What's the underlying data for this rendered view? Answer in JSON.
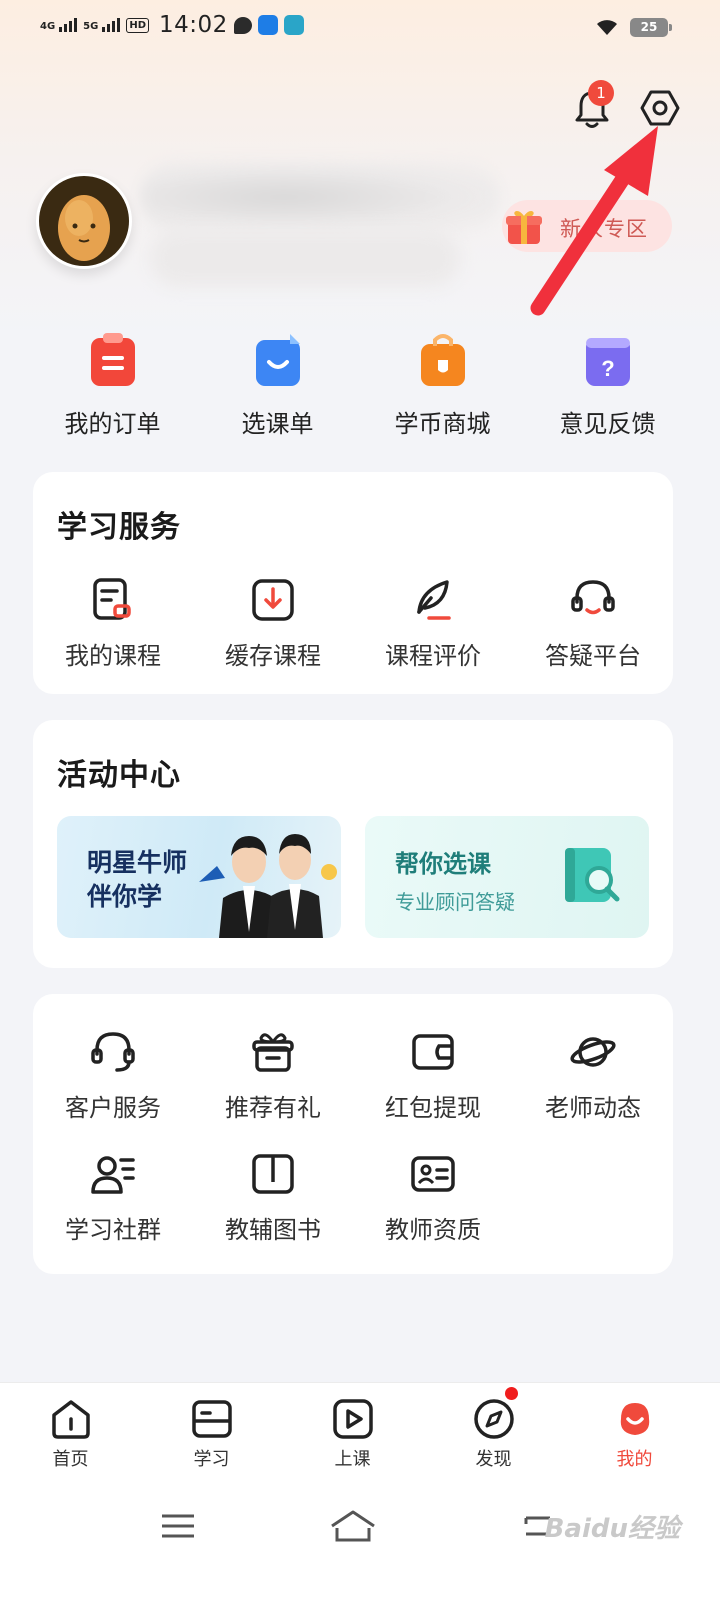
{
  "status_bar": {
    "signal1": "4G",
    "signal2": "5G",
    "hd": "HD",
    "time": "14:02",
    "battery": "25"
  },
  "header": {
    "notification_count": "1"
  },
  "profile": {
    "promo_label": "新人专区"
  },
  "quick_nav": [
    {
      "label": "我的订单",
      "icon": "order-icon",
      "color": "#f2473a"
    },
    {
      "label": "选课单",
      "icon": "course-list-icon",
      "color": "#3d86f4"
    },
    {
      "label": "学币商城",
      "icon": "shop-icon",
      "color": "#f5861f"
    },
    {
      "label": "意见反馈",
      "icon": "feedback-icon",
      "color": "#7b6cf0"
    }
  ],
  "study_services": {
    "title": "学习服务",
    "items": [
      {
        "label": "我的课程",
        "icon": "my-course-icon"
      },
      {
        "label": "缓存课程",
        "icon": "download-icon"
      },
      {
        "label": "课程评价",
        "icon": "review-pen-icon"
      },
      {
        "label": "答疑平台",
        "icon": "headset-icon"
      }
    ]
  },
  "activity_center": {
    "title": "活动中心",
    "banner1": {
      "line1": "明星牛师",
      "line2": "伴你学"
    },
    "banner2": {
      "title": "帮你选课",
      "subtitle": "专业顾问答疑"
    }
  },
  "more_services": {
    "row1": [
      {
        "label": "客户服务",
        "icon": "customer-service-icon"
      },
      {
        "label": "推荐有礼",
        "icon": "gift-icon"
      },
      {
        "label": "红包提现",
        "icon": "wallet-icon"
      },
      {
        "label": "老师动态",
        "icon": "planet-icon"
      }
    ],
    "row2": [
      {
        "label": "学习社群",
        "icon": "community-icon"
      },
      {
        "label": "教辅图书",
        "icon": "book-icon"
      },
      {
        "label": "教师资质",
        "icon": "id-card-icon"
      }
    ]
  },
  "tabbar": {
    "tabs": [
      {
        "label": "首页",
        "icon": "home-icon"
      },
      {
        "label": "学习",
        "icon": "study-icon"
      },
      {
        "label": "上课",
        "icon": "play-icon"
      },
      {
        "label": "发现",
        "icon": "compass-icon"
      },
      {
        "label": "我的",
        "icon": "profile-face-icon",
        "active": true
      }
    ]
  },
  "watermark": "Baidu经验",
  "colors": {
    "accent": "#f04a3c",
    "arrow": "#f0303c"
  }
}
